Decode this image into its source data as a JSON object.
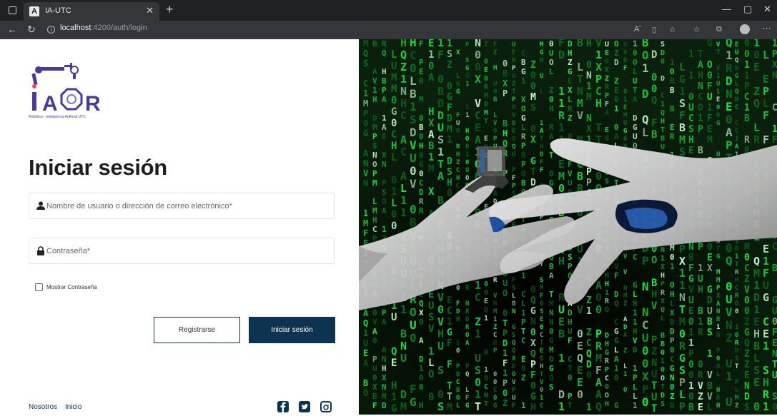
{
  "browser": {
    "tab_title": "IA-UTC",
    "tab_favicon": "A",
    "url_host": "localhost",
    "url_path": ":4200/auth/login",
    "icons": [
      "window-icon",
      "close-tab-icon",
      "new-tab-icon",
      "back-icon",
      "refresh-icon",
      "info-icon",
      "read-aloud-icon",
      "reader-icon",
      "favorite-icon",
      "favorites-icon",
      "collections-icon",
      "profile-icon",
      "more-icon"
    ]
  },
  "logo": {
    "text": "IAR",
    "caption": "Robótica - Inteligencia Artificial UTC"
  },
  "login": {
    "heading": "Iniciar sesión",
    "username_placeholder": "Nombre de usuario o dirección de correo electrónico*",
    "password_placeholder": "Contraseña*",
    "show_password_label": "Mostrar Contraseña",
    "register_label": "Registrarse",
    "submit_label": "Iniciar sesión"
  },
  "footer": {
    "links": [
      "Nosotros",
      "Inicio"
    ],
    "social": [
      "facebook-icon",
      "twitter-icon",
      "instagram-icon"
    ]
  },
  "colors": {
    "primary": "#0d3351",
    "matrix_green": "#1ee84a",
    "browser_dark": "#202124"
  }
}
